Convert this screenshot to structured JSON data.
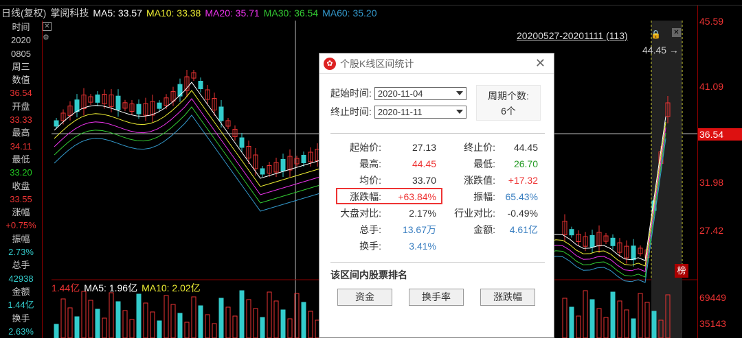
{
  "header": {
    "mode": "日线(复权)",
    "stock": "掌阅科技",
    "ma5": "MA5: 33.57",
    "ma10": "MA10: 33.38",
    "ma20": "MA20: 35.71",
    "ma30": "MA30: 36.54",
    "ma60": "MA60: 35.20"
  },
  "left_panel": [
    {
      "label": "时间",
      "value": "2020",
      "color": "#ccc"
    },
    {
      "label": "0805",
      "value": "周三",
      "color": "#ccc"
    },
    {
      "label": "数值",
      "value": "36.54",
      "color": "#e33"
    },
    {
      "label": "开盘",
      "value": "33.33",
      "color": "#e33"
    },
    {
      "label": "最高",
      "value": "34.11",
      "color": "#e33"
    },
    {
      "label": "最低",
      "value": "33.20",
      "color": "#2c2"
    },
    {
      "label": "收盘",
      "value": "33.55",
      "color": "#e33"
    },
    {
      "label": "涨幅",
      "value": "+0.75%",
      "color": "#e33"
    },
    {
      "label": "振幅",
      "value": "2.73%",
      "color": "#3cc"
    },
    {
      "label": "总手",
      "value": "42938",
      "color": "#3cc"
    },
    {
      "label": "金额",
      "value": "1.44亿",
      "color": "#3cc"
    },
    {
      "label": "换手",
      "value": "2.63%",
      "color": "#3cc"
    }
  ],
  "right_axis": {
    "ticks": [
      "45.59",
      "41.09",
      "31.98",
      "27.42",
      "69449",
      "35143"
    ],
    "current": "36.54"
  },
  "range_label": "20200527-20201111 (113)",
  "peak_label": "44.45",
  "bang_label": "榜",
  "volume_header": {
    "amount": "1.44亿",
    "ma5": "MA5: 1.96亿",
    "ma10": "MA10: 2.02亿"
  },
  "dialog": {
    "title": "个股K线区间统计",
    "start_label": "起始时间:",
    "start_value": "2020-11-04",
    "end_label": "终止时间:",
    "end_value": "2020-11-11",
    "period_label": "周期个数:",
    "period_value": "6个",
    "stats": [
      {
        "k1": "起始价:",
        "v1": "27.13",
        "c1": "dark",
        "k2": "终止价:",
        "v2": "44.45",
        "c2": "dark"
      },
      {
        "k1": "最高:",
        "v1": "44.45",
        "c1": "red",
        "k2": "最低:",
        "v2": "26.70",
        "c2": "green"
      },
      {
        "k1": "均价:",
        "v1": "33.70",
        "c1": "dark",
        "k2": "涨跌值:",
        "v2": "+17.32",
        "c2": "red"
      },
      {
        "k1": "涨跌幅:",
        "v1": "+63.84%",
        "c1": "red",
        "k2": "振幅:",
        "v2": "65.43%",
        "c2": "blue"
      },
      {
        "k1": "大盘对比:",
        "v1": "2.17%",
        "c1": "dark",
        "k2": "行业对比:",
        "v2": "-0.49%",
        "c2": "dark"
      },
      {
        "k1": "总手:",
        "v1": "13.67万",
        "c1": "blue",
        "k2": "金额:",
        "v2": "4.61亿",
        "c2": "blue"
      },
      {
        "k1": "换手:",
        "v1": "3.41%",
        "c1": "blue",
        "k2": "",
        "v2": "",
        "c2": "dark"
      }
    ],
    "rank_title": "该区间内股票排名",
    "btn_amount": "资金",
    "btn_turnover": "换手率",
    "btn_change": "涨跌幅"
  }
}
